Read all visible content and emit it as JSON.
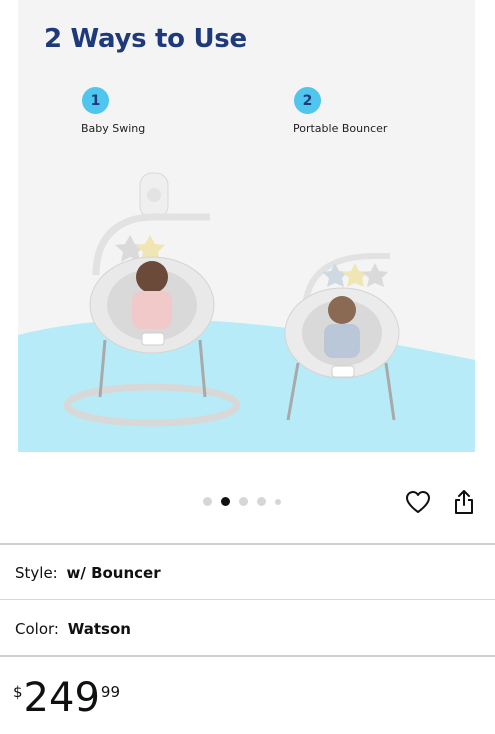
{
  "product_image": {
    "title": "2 Ways to Use",
    "steps": [
      {
        "number": "1",
        "label": "Baby Swing"
      },
      {
        "number": "2",
        "label": "Portable Bouncer"
      }
    ]
  },
  "carousel": {
    "total_dots": 5,
    "active_index": 1
  },
  "style": {
    "label": "Style:",
    "value": "w/ Bouncer"
  },
  "color": {
    "label": "Color:",
    "value": "Watson"
  },
  "price": {
    "symbol": "$",
    "whole": "249",
    "fraction": "99"
  },
  "colors": {
    "title": "#1f3a7a",
    "badge": "#4fc6ee",
    "wave": "#b8ebf8",
    "active_dot": "#111111",
    "inactive_dot": "#d6d6d6"
  },
  "icons": {
    "favorite": "heart-icon",
    "share": "share-icon"
  }
}
